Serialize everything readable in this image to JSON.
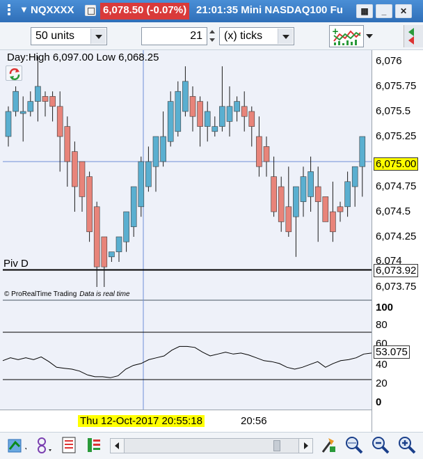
{
  "titlebar": {
    "symbol": "NQXXXX",
    "price_change": "6,078.50 (-0.07%)",
    "time_and_name": "21:01:35 Mini NASDAQ100 Fu",
    "min_glyph": "_",
    "close_glyph": "✕"
  },
  "toolbar": {
    "units_value": "50 units",
    "ticks_number": "21",
    "ticks_unit": "(x) ticks"
  },
  "chart": {
    "info_text": "Day:High 6,097.00 Low 6,068.25",
    "pivot_label": "Piv D",
    "footnote_brand": "© ProRealTime Trading",
    "footnote_status": "Data is real time",
    "price_axis": [
      "6,076",
      "6,075.75",
      "6,075.5",
      "6,075.25",
      "6,075.00",
      "6,074.75",
      "6,074.5",
      "6,074.25",
      "6,074",
      "6,073.92",
      "6,073.75"
    ],
    "current_price": "6,075.00",
    "pivot_value": "6,073.92",
    "indicator_axis": [
      "100",
      "80",
      "60",
      "53.075",
      "40",
      "20",
      "0"
    ],
    "indicator_current": "53.075",
    "x_cursor_label": "Thu 12-Oct-2017 20:55:18",
    "x_label": "20:56",
    "colors": {
      "up": "#5aafd0",
      "down": "#e8847a",
      "bg": "#eef1f9",
      "crosshair": "#6f8fd8"
    }
  },
  "chart_data": {
    "type": "candlestick",
    "ylim": [
      6073.7,
      6076.1
    ],
    "candles": [
      {
        "o": 6075.25,
        "h": 6075.55,
        "l": 6075.15,
        "c": 6075.5
      },
      {
        "o": 6075.5,
        "h": 6075.75,
        "l": 6075.45,
        "c": 6075.7
      },
      {
        "o": 6075.5,
        "h": 6075.65,
        "l": 6075.2,
        "c": 6075.5
      },
      {
        "o": 6075.5,
        "h": 6075.7,
        "l": 6075.45,
        "c": 6075.6
      },
      {
        "o": 6075.6,
        "h": 6076.05,
        "l": 6075.4,
        "c": 6075.75
      },
      {
        "o": 6075.65,
        "h": 6075.7,
        "l": 6075.45,
        "c": 6075.6
      },
      {
        "o": 6075.65,
        "h": 6075.7,
        "l": 6075.4,
        "c": 6075.55
      },
      {
        "o": 6075.55,
        "h": 6075.7,
        "l": 6074.9,
        "c": 6075.25
      },
      {
        "o": 6075.35,
        "h": 6075.45,
        "l": 6074.75,
        "c": 6075.0
      },
      {
        "o": 6075.1,
        "h": 6075.2,
        "l": 6074.5,
        "c": 6074.75
      },
      {
        "o": 6075.0,
        "h": 6075.0,
        "l": 6074.5,
        "c": 6074.65
      },
      {
        "o": 6074.85,
        "h": 6074.9,
        "l": 6074.2,
        "c": 6074.3
      },
      {
        "o": 6074.55,
        "h": 6074.6,
        "l": 6073.75,
        "c": 6073.95
      },
      {
        "o": 6074.25,
        "h": 6074.25,
        "l": 6073.75,
        "c": 6073.95
      },
      {
        "o": 6074.05,
        "h": 6074.1,
        "l": 6074.0,
        "c": 6074.1
      },
      {
        "o": 6074.1,
        "h": 6074.25,
        "l": 6074.0,
        "c": 6074.25
      },
      {
        "o": 6074.2,
        "h": 6074.45,
        "l": 6074.1,
        "c": 6074.5
      },
      {
        "o": 6074.35,
        "h": 6074.75,
        "l": 6074.25,
        "c": 6074.75
      },
      {
        "o": 6074.55,
        "h": 6075.05,
        "l": 6074.45,
        "c": 6075.0
      },
      {
        "o": 6074.75,
        "h": 6075.15,
        "l": 6074.7,
        "c": 6075.0
      },
      {
        "o": 6074.95,
        "h": 6075.1,
        "l": 6074.7,
        "c": 6075.25
      },
      {
        "o": 6075.0,
        "h": 6075.5,
        "l": 6074.95,
        "c": 6075.25
      },
      {
        "o": 6075.2,
        "h": 6075.7,
        "l": 6075.15,
        "c": 6075.6
      },
      {
        "o": 6075.3,
        "h": 6075.8,
        "l": 6075.25,
        "c": 6075.7
      },
      {
        "o": 6075.5,
        "h": 6075.95,
        "l": 6075.45,
        "c": 6075.8
      },
      {
        "o": 6075.65,
        "h": 6075.75,
        "l": 6075.3,
        "c": 6075.45
      },
      {
        "o": 6075.6,
        "h": 6075.65,
        "l": 6075.15,
        "c": 6075.35
      },
      {
        "o": 6075.35,
        "h": 6075.6,
        "l": 6075.2,
        "c": 6075.5
      },
      {
        "o": 6075.3,
        "h": 6075.45,
        "l": 6075.25,
        "c": 6075.35
      },
      {
        "o": 6075.35,
        "h": 6075.95,
        "l": 6075.3,
        "c": 6075.55
      },
      {
        "o": 6075.4,
        "h": 6075.75,
        "l": 6075.25,
        "c": 6075.55
      },
      {
        "o": 6075.5,
        "h": 6075.65,
        "l": 6075.4,
        "c": 6075.6
      },
      {
        "o": 6075.55,
        "h": 6075.7,
        "l": 6075.3,
        "c": 6075.45
      },
      {
        "o": 6075.5,
        "h": 6075.55,
        "l": 6075.15,
        "c": 6075.35
      },
      {
        "o": 6075.25,
        "h": 6075.45,
        "l": 6074.85,
        "c": 6074.95
      },
      {
        "o": 6075.15,
        "h": 6075.25,
        "l": 6074.85,
        "c": 6075.0
      },
      {
        "o": 6074.85,
        "h": 6075.05,
        "l": 6074.45,
        "c": 6074.5
      },
      {
        "o": 6074.75,
        "h": 6074.85,
        "l": 6074.3,
        "c": 6074.4
      },
      {
        "o": 6074.55,
        "h": 6074.95,
        "l": 6074.25,
        "c": 6074.3
      },
      {
        "o": 6074.45,
        "h": 6074.75,
        "l": 6074.05,
        "c": 6074.75
      },
      {
        "o": 6074.6,
        "h": 6074.95,
        "l": 6074.45,
        "c": 6074.85
      },
      {
        "o": 6074.65,
        "h": 6075.05,
        "l": 6074.5,
        "c": 6074.9
      },
      {
        "o": 6074.75,
        "h": 6074.95,
        "l": 6074.2,
        "c": 6074.6
      },
      {
        "o": 6074.65,
        "h": 6074.65,
        "l": 6074.4,
        "c": 6074.4
      },
      {
        "o": 6074.5,
        "h": 6074.8,
        "l": 6074.2,
        "c": 6074.3
      },
      {
        "o": 6074.55,
        "h": 6074.6,
        "l": 6074.4,
        "c": 6074.5
      },
      {
        "o": 6074.55,
        "h": 6074.9,
        "l": 6074.45,
        "c": 6074.8
      },
      {
        "o": 6074.75,
        "h": 6074.95,
        "l": 6074.55,
        "c": 6074.95
      },
      {
        "o": 6074.95,
        "h": 6075.0,
        "l": 6074.65,
        "c": 6075.25
      }
    ],
    "current_price": 6075.0,
    "pivot": 6073.92,
    "indicator": {
      "ylim": [
        0,
        100
      ],
      "levels": [
        75,
        25
      ],
      "values": [
        45,
        48,
        46,
        48,
        46,
        49,
        44,
        38,
        37,
        36,
        34,
        30,
        28,
        28,
        27,
        29,
        36,
        40,
        42,
        46,
        48,
        50,
        56,
        60,
        60,
        59,
        54,
        50,
        52,
        54,
        52,
        53,
        51,
        48,
        45,
        44,
        42,
        38,
        36,
        38,
        41,
        44,
        38,
        42,
        45,
        46,
        48,
        52,
        53
      ]
    }
  }
}
